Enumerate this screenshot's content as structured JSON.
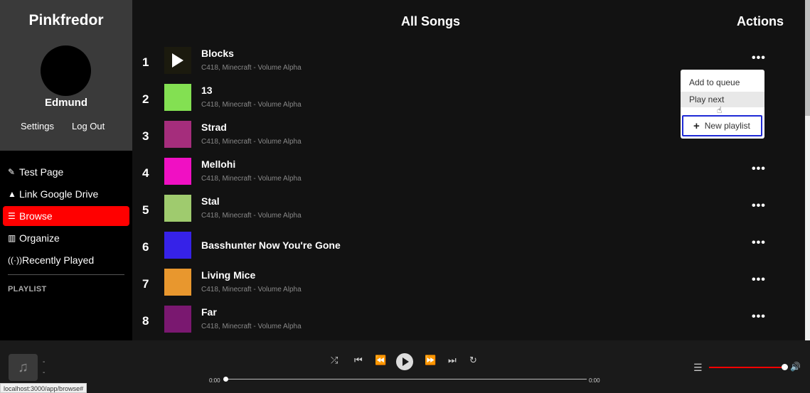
{
  "app": {
    "title": "Pinkfredor"
  },
  "profile": {
    "username": "Edmund",
    "settings_label": "Settings",
    "logout_label": "Log Out"
  },
  "nav": {
    "items": [
      {
        "label": "Test Page",
        "icon": "pencil-icon"
      },
      {
        "label": "Link Google Drive",
        "icon": "google-drive-icon"
      },
      {
        "label": "Browse",
        "icon": "list-icon",
        "active": true
      },
      {
        "label": "Organize",
        "icon": "columns-icon"
      },
      {
        "label": "Recently Played",
        "icon": "broadcast-icon"
      }
    ],
    "playlist_heading": "PLAYLIST"
  },
  "main": {
    "title": "All Songs",
    "actions_label": "Actions",
    "songs": [
      {
        "num": "1",
        "title": "Blocks",
        "subtitle": "C418, Minecraft - Volume Alpha",
        "color": "#1b1a0e"
      },
      {
        "num": "2",
        "title": "13",
        "subtitle": "C418, Minecraft - Volume Alpha",
        "color": "#83e052"
      },
      {
        "num": "3",
        "title": "Strad",
        "subtitle": "C418, Minecraft - Volume Alpha",
        "color": "#a52d7c"
      },
      {
        "num": "4",
        "title": "Mellohi",
        "subtitle": "C418, Minecraft - Volume Alpha",
        "color": "#f010c3"
      },
      {
        "num": "5",
        "title": "Stal",
        "subtitle": "C418, Minecraft - Volume Alpha",
        "color": "#9fcb6e"
      },
      {
        "num": "6",
        "title": "Basshunter Now You're Gone",
        "subtitle": "",
        "color": "#3622e8"
      },
      {
        "num": "7",
        "title": "Living Mice",
        "subtitle": "C418, Minecraft - Volume Alpha",
        "color": "#e8972e"
      },
      {
        "num": "8",
        "title": "Far",
        "subtitle": "C418, Minecraft - Volume Alpha",
        "color": "#7a1870"
      }
    ]
  },
  "dropdown": {
    "add_to_queue": "Add to queue",
    "play_next": "Play next",
    "new_playlist": "New playlist"
  },
  "player": {
    "track_title": "-",
    "track_artist": "-",
    "current_time": "0:00",
    "total_time": "0:00",
    "progress": 0,
    "volume": 1.0,
    "accent_color": "#ff0000"
  },
  "status_url": "localhost:3000/app/browse#"
}
